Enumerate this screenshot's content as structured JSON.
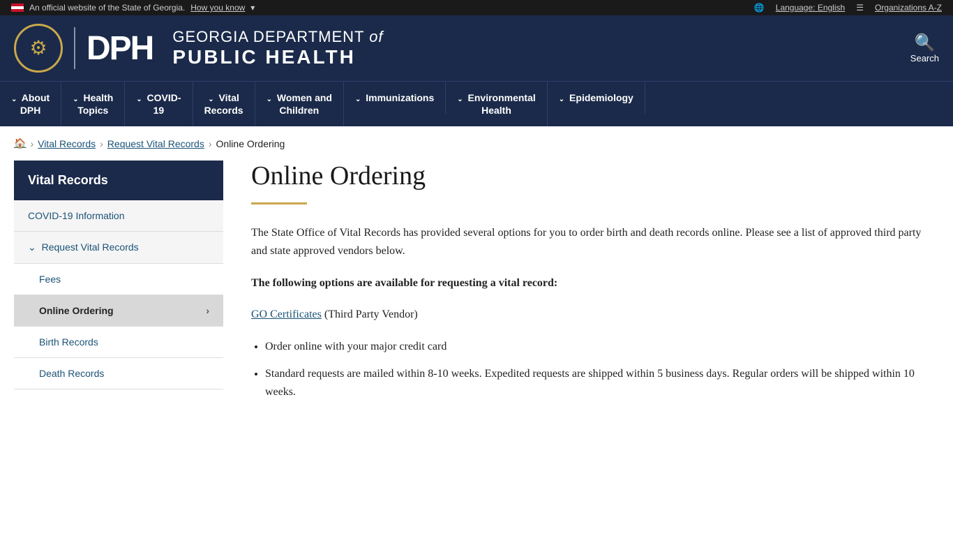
{
  "topbar": {
    "official_text": "An official website of the State of Georgia.",
    "how_you_know": "How you know",
    "language_label": "Language: English",
    "organizations_label": "Organizations A-Z"
  },
  "header": {
    "logo_icon": "⚙",
    "dept_line1": "GEORGIA DEPARTMENT",
    "dept_of": "of",
    "dept_line2": "PUBLIC HEALTH",
    "search_label": "Search"
  },
  "nav": {
    "items": [
      {
        "id": "about-dph",
        "label": "About DPH"
      },
      {
        "id": "health-topics",
        "label": "Health Topics"
      },
      {
        "id": "covid-19",
        "label": "COVID-19"
      },
      {
        "id": "vital-records",
        "label": "Vital Records"
      },
      {
        "id": "women-children",
        "label": "Women and Children"
      },
      {
        "id": "immunizations",
        "label": "Immunizations"
      },
      {
        "id": "environmental-health",
        "label": "Environmental Health"
      },
      {
        "id": "epidemiology",
        "label": "Epidemiology"
      }
    ]
  },
  "breadcrumb": {
    "home_aria": "Home",
    "vital_records": "Vital Records",
    "request_vital_records": "Request Vital Records",
    "current": "Online Ordering"
  },
  "sidebar": {
    "title": "Vital Records",
    "items": [
      {
        "id": "covid-info",
        "label": "COVID-19 Information",
        "active": false,
        "sub": false
      },
      {
        "id": "request-vital-records",
        "label": "Request Vital Records",
        "active": false,
        "expanded": true,
        "sub": false
      },
      {
        "id": "fees",
        "label": "Fees",
        "active": false,
        "sub": true
      },
      {
        "id": "online-ordering",
        "label": "Online Ordering",
        "active": true,
        "sub": true
      },
      {
        "id": "birth-records",
        "label": "Birth Records",
        "active": false,
        "sub": true
      },
      {
        "id": "death-records",
        "label": "Death Records",
        "active": false,
        "sub": true
      }
    ]
  },
  "content": {
    "page_title": "Online Ordering",
    "intro": "The State Office of Vital Records has provided several options for you to order birth and death records online. Please see a list of approved third party and state approved vendors below.",
    "options_heading": "The following options are available for requesting a vital record:",
    "vendor_name": "GO Certificates",
    "vendor_type": "(Third Party Vendor)",
    "bullets": [
      "Order online with your major credit card",
      "Standard requests are mailed within 8-10 weeks. Expedited requests are shipped within 5 business days. Regular orders will be shipped within 10 weeks."
    ]
  }
}
